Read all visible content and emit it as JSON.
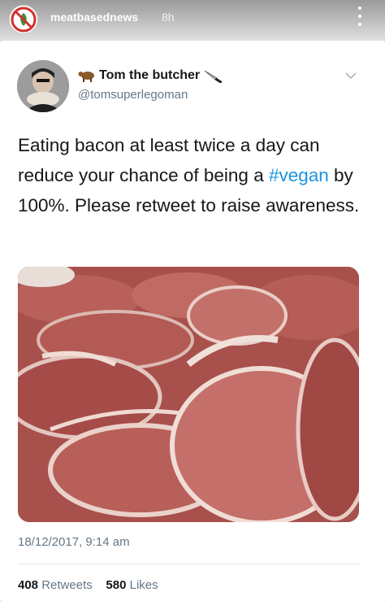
{
  "story": {
    "username": "meatbasednews",
    "time": "8h",
    "avatar_icon": "no-vegan-icon",
    "more_icon": "more-vertical-icon"
  },
  "tweet": {
    "display_name": "Tom the butcher",
    "handle": "@tomsuperlegoman",
    "name_prefix_icon": "cow-icon",
    "name_suffix_icon": "knife-icon",
    "text_before": "Eating bacon at least twice a day can reduce your chance of being a ",
    "hashtag": "#vegan",
    "text_after": " by 100%. Please retweet to raise awareness.",
    "photo": "raw-pork-chops-photo",
    "timestamp": "18/12/2017, 9:14 am",
    "retweets_count": "408",
    "retweets_label": "Retweets",
    "likes_count": "580",
    "likes_label": "Likes"
  },
  "colors": {
    "hashtag": "#1b95e0",
    "secondary_text": "#657786",
    "meat": "#b5554f"
  }
}
